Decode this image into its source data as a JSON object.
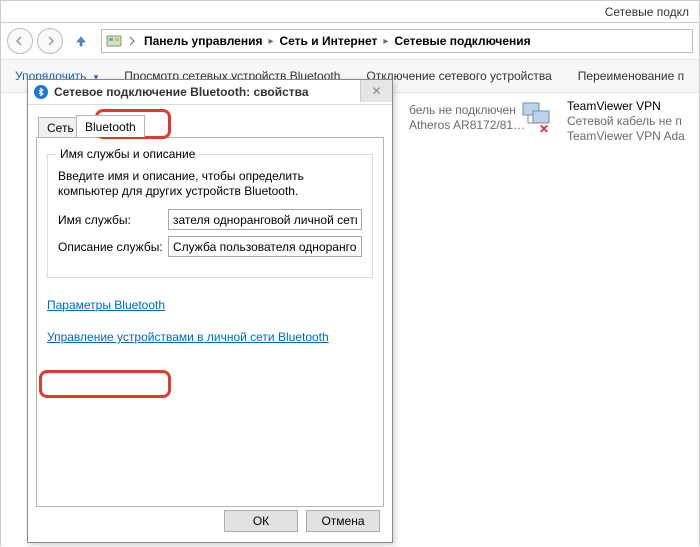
{
  "window_title": "Сетевые подкл",
  "breadcrumbs": [
    "Панель управления",
    "Сеть и Интернет",
    "Сетевые подключения"
  ],
  "toolbar": {
    "organize": "Упорядочить",
    "view_bt": "Просмотр сетевых устройств Bluetooth",
    "disable": "Отключение сетевого устройства",
    "rename": "Переименование п"
  },
  "bg": {
    "line1": "бель не подключен",
    "line2": "Atheros AR8172/81…"
  },
  "tv": {
    "title": "TeamViewer VPN",
    "sub1": "Сетевой кабель не п",
    "sub2": "TeamViewer VPN Ada"
  },
  "dialog": {
    "title": "Сетевое подключение Bluetooth: свойства",
    "tab_net": "Сеть",
    "tab_bt": "Bluetooth",
    "group_legend": "Имя службы и описание",
    "group_text": "Введите имя и описание, чтобы определить компьютер для других устройств Bluetooth.",
    "name_label": "Имя службы:",
    "name_value": "зателя одноранговой личной сети",
    "desc_label": "Описание службы:",
    "desc_value": "Служба пользователя одноранговой",
    "link1": "Параметры Bluetooth",
    "link2": "Управление устройствами в личной сети Bluetooth",
    "ok": "ОК",
    "cancel": "Отмена"
  }
}
